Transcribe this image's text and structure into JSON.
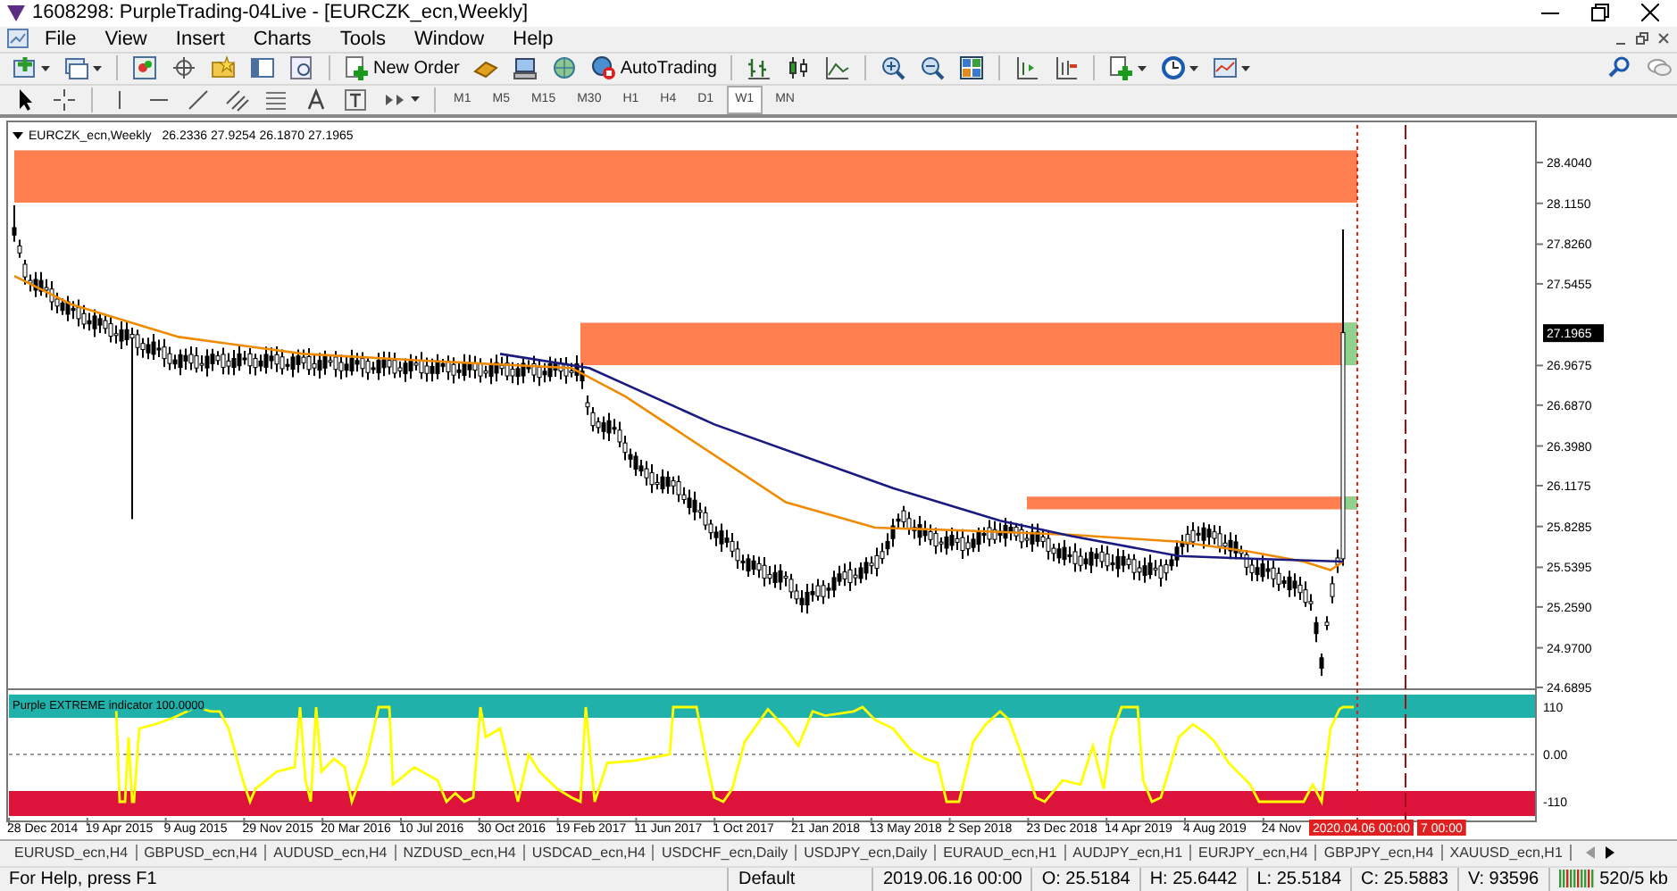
{
  "window": {
    "title": "1608298: PurpleTrading-04Live - [EURCZK_ecn,Weekly]"
  },
  "menu": [
    "File",
    "View",
    "Insert",
    "Charts",
    "Tools",
    "Window",
    "Help"
  ],
  "toolbar": {
    "new_order": "New Order",
    "auto_trading": "AutoTrading"
  },
  "timeframes": [
    {
      "label": "M1",
      "selected": false
    },
    {
      "label": "M5",
      "selected": false
    },
    {
      "label": "M15",
      "selected": false
    },
    {
      "label": "M30",
      "selected": false
    },
    {
      "label": "H1",
      "selected": false
    },
    {
      "label": "H4",
      "selected": false
    },
    {
      "label": "D1",
      "selected": false
    },
    {
      "label": "W1",
      "selected": true
    },
    {
      "label": "MN",
      "selected": false
    }
  ],
  "chart": {
    "symbol": "EURCZK_ecn,Weekly",
    "ohlc": "26.2336 27.9254 26.1870 27.1965",
    "price_ticks": [
      "28.4040",
      "28.1150",
      "27.8260",
      "27.5455",
      "26.9675",
      "26.6870",
      "26.3980",
      "26.1175",
      "25.8285",
      "25.5395",
      "25.2590",
      "24.9700",
      "24.6895"
    ],
    "current_price": "27.1965",
    "indicator": {
      "label": "Purple EXTREME indicator 100.0000",
      "ticks": [
        "110",
        "0.00",
        "-110"
      ]
    },
    "date_ticks": [
      "28 Dec 2014",
      "19 Apr 2015",
      "9 Aug 2015",
      "29 Nov 2015",
      "20 Mar 2016",
      "10 Jul 2016",
      "30 Oct 2016",
      "19 Feb 2017",
      "11 Jun 2017",
      "1 Oct 2017",
      "21 Jan 2018",
      "13 May 2018",
      "2 Sep 2018",
      "23 Dec 2018",
      "14 Apr 2019",
      "4 Aug 2019",
      "24 Nov"
    ],
    "time_markers": [
      "2020.04.06 00:00",
      "7 00:00"
    ]
  },
  "tabs": [
    {
      "label": "EURUSD_ecn,H4",
      "selected": false
    },
    {
      "label": "GBPUSD_ecn,H4",
      "selected": false
    },
    {
      "label": "AUDUSD_ecn,H4",
      "selected": false
    },
    {
      "label": "NZDUSD_ecn,H4",
      "selected": false
    },
    {
      "label": "USDCAD_ecn,H4",
      "selected": false
    },
    {
      "label": "USDCHF_ecn,Daily",
      "selected": false
    },
    {
      "label": "USDJPY_ecn,Daily",
      "selected": false
    },
    {
      "label": "EURAUD_ecn,H1",
      "selected": false
    },
    {
      "label": "AUDJPY_ecn,H1",
      "selected": false
    },
    {
      "label": "EURJPY_ecn,H4",
      "selected": false
    },
    {
      "label": "GBPJPY_ecn,H4",
      "selected": false
    },
    {
      "label": "XAUUSD_ecn,H1",
      "selected": false
    }
  ],
  "status_bar": {
    "help": "For Help, press F1",
    "profile": "Default",
    "time": "2019.06.16 00:00",
    "open": "O: 25.5184",
    "high": "H: 25.6442",
    "low": "L: 25.5184",
    "close": "C: 25.5883",
    "volume": "V: 93596",
    "traffic": "520/5 kb"
  }
}
